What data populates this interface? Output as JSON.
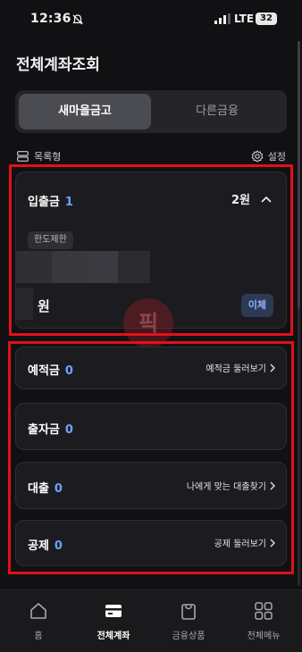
{
  "status_bar": {
    "time": "12:36",
    "network": "LTE",
    "battery": "32"
  },
  "page": {
    "title": "전체계좌조회"
  },
  "segment": {
    "tabs": [
      {
        "label": "새마을금고",
        "active": true
      },
      {
        "label": "다른금융",
        "active": false
      }
    ]
  },
  "view_mode": {
    "label": "목록형"
  },
  "settings": {
    "label": "설정"
  },
  "deposit_card": {
    "label": "입출금",
    "count": "1",
    "total": "2원",
    "limit_badge": "한도제한",
    "balance": "원",
    "transfer_label": "이체"
  },
  "watermark": {
    "text": "픽"
  },
  "sections": [
    {
      "label": "예적금",
      "count": "0",
      "action": "예적금 둘러보기"
    },
    {
      "label": "출자금",
      "count": "0",
      "action": ""
    },
    {
      "label": "대출",
      "count": "0",
      "action": "나에게 맞는 대출찾기"
    },
    {
      "label": "공제",
      "count": "0",
      "action": "공제 둘러보기"
    }
  ],
  "bottom_nav": {
    "items": [
      {
        "label": "홈",
        "icon": "home-icon",
        "active": false
      },
      {
        "label": "전체계좌",
        "icon": "card-icon",
        "active": true
      },
      {
        "label": "금융상품",
        "icon": "bag-icon",
        "active": false
      },
      {
        "label": "전체메뉴",
        "icon": "grid-icon",
        "active": false
      }
    ]
  },
  "colors": {
    "background": "#111113",
    "card": "#1c1c20",
    "accent": "#6ea2ff",
    "highlight_border": "#e0111c"
  }
}
